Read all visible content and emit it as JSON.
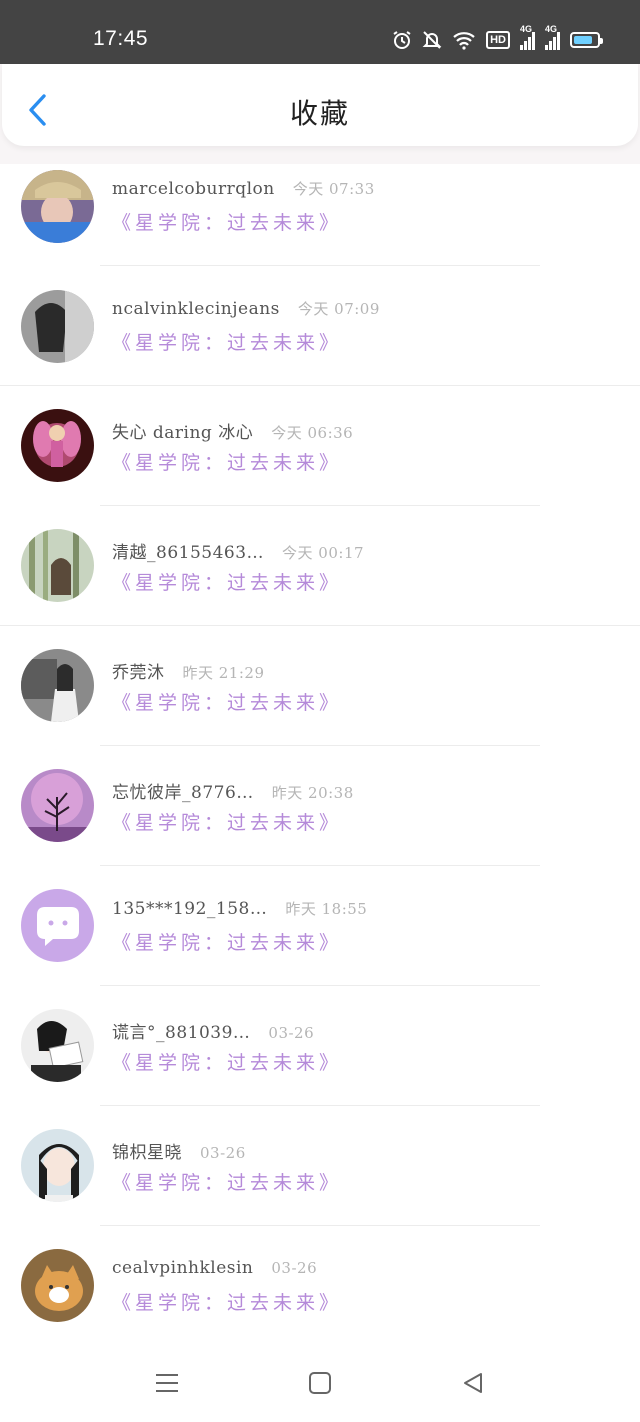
{
  "status_bar": {
    "time": "17:45",
    "hd_label": "HD",
    "net1": "4G",
    "net2": "4G",
    "icons": [
      "alarm-icon",
      "mute-bell-icon",
      "wifi-icon",
      "hd-icon",
      "signal-icon",
      "signal-icon",
      "battery-icon"
    ]
  },
  "header": {
    "title": "收藏",
    "back_icon": "chevron-left-icon",
    "accent": "#2a8ef0"
  },
  "favorites": [
    {
      "user": "marcelcoburrqlon",
      "time": "今天 07:33",
      "work": "《星学院：过去未来》"
    },
    {
      "user": "ncalvinklecinjeans",
      "time": "今天 07:09",
      "work": "《星学院：过去未来》"
    },
    {
      "user": "失心 daring 冰心",
      "time": "今天 06:36",
      "work": "《星学院：过去未来》"
    },
    {
      "user": "清越_86155463…",
      "time": "今天 00:17",
      "work": "《星学院：过去未来》"
    },
    {
      "user": "乔莞沐",
      "time": "昨天 21:29",
      "work": "《星学院：过去未来》"
    },
    {
      "user": "忘忧彼岸_8776…",
      "time": "昨天 20:38",
      "work": "《星学院：过去未来》"
    },
    {
      "user": "135***192_158…",
      "time": "昨天 18:55",
      "work": "《星学院：过去未来》"
    },
    {
      "user": "谎言°_881039…",
      "time": "03-26",
      "work": "《星学院：过去未来》"
    },
    {
      "user": "锦枳星晓",
      "time": "03-26",
      "work": "《星学院：过去未来》"
    },
    {
      "user": "cealvpinhklesin",
      "time": "03-26",
      "work": "《星学院：过去未来》"
    }
  ],
  "colors": {
    "work_title": "#b58ad9",
    "username": "#555555",
    "timestamp": "#b5b5b5"
  },
  "nav": {
    "icons": [
      "menu-icon",
      "home-square-icon",
      "back-triangle-icon"
    ]
  }
}
